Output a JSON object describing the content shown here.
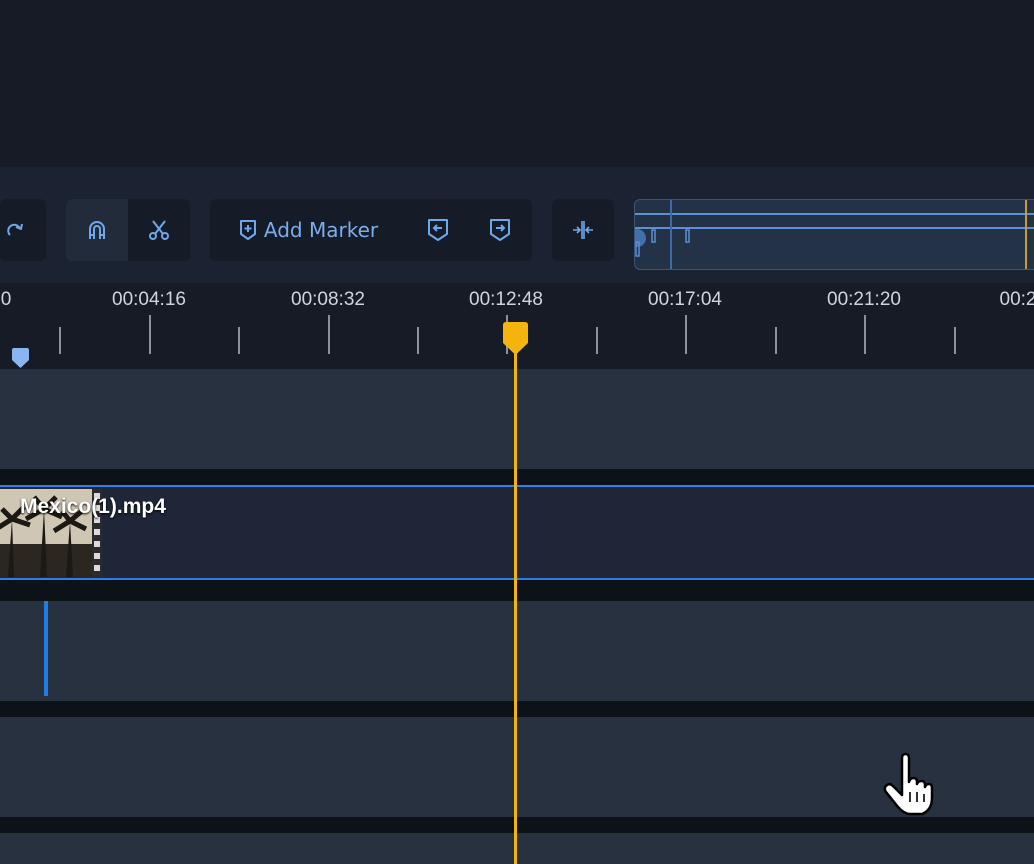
{
  "toolbar": {
    "add_marker_label": "Add Marker",
    "buttons": [
      "redo-icon",
      "magnet-icon",
      "scissors-icon",
      "marker-add-icon",
      "prev-marker-icon",
      "next-marker-icon",
      "fit-timeline-icon"
    ],
    "magnet_active": true
  },
  "ruler": {
    "labels": [
      "0",
      "00:04:16",
      "00:08:32",
      "00:12:48",
      "00:17:04",
      "00:21:20",
      "00:2"
    ]
  },
  "clip": {
    "name": "Mexico(1).mp4"
  },
  "colors": {
    "background": "#161b25",
    "toolbar": "#1b2332",
    "track": "#273140",
    "clip_border": "#2f7de8",
    "playhead": "#f5b40d",
    "icon": "#6fa8ea"
  },
  "playhead_time": "00:12:48"
}
